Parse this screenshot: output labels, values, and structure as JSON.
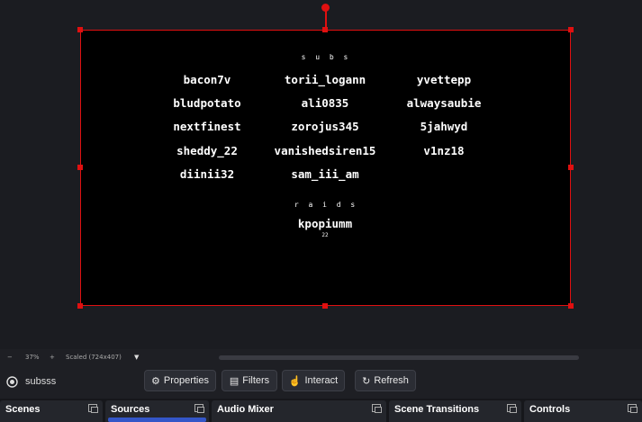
{
  "preview": {
    "subs_heading": "s u b s",
    "subs": [
      [
        "bacon7v",
        "torii_logann",
        "yvettepp"
      ],
      [
        "bludpotato",
        "ali0835",
        "alwaysaubie"
      ],
      [
        "nextfinest",
        "zorojus345",
        "5jahwyd"
      ],
      [
        "sheddy_22",
        "vanishedsiren15",
        "v1nz18"
      ],
      [
        "diinii32",
        "sam_iii_am",
        ""
      ]
    ],
    "raids_heading": "r a i d s",
    "raid_name": "kpopiumm",
    "raid_count": "22"
  },
  "zoom": {
    "minus": "−",
    "level": "37%",
    "plus": "+",
    "mode": "Scaled (724x407)",
    "dropdown": "▼"
  },
  "scene_bar": {
    "scene_name": "subsss",
    "properties": "Properties",
    "filters": "Filters",
    "interact": "Interact",
    "refresh": "Refresh"
  },
  "docks": {
    "scenes": "Scenes",
    "sources": "Sources",
    "audio_mixer": "Audio Mixer",
    "scene_transitions": "Scene Transitions",
    "controls": "Controls"
  }
}
